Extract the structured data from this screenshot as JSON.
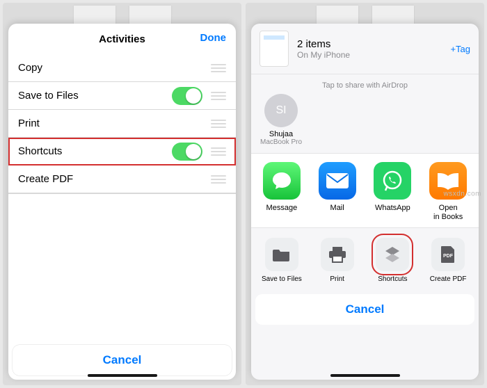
{
  "watermark": "wsxdn.com",
  "panel1": {
    "title": "Activities",
    "done": "Done",
    "rows": [
      {
        "label": "Copy",
        "toggle": null
      },
      {
        "label": "Save to Files",
        "toggle": true
      },
      {
        "label": "Print",
        "toggle": null
      },
      {
        "label": "Shortcuts",
        "toggle": true,
        "highlight": true
      },
      {
        "label": "Create PDF",
        "toggle": null
      }
    ],
    "cancel": "Cancel"
  },
  "panel2": {
    "header": {
      "items": "2 items",
      "location": "On My iPhone",
      "tag": "+Tag"
    },
    "airdrop": {
      "caption": "Tap to share with AirDrop",
      "contacts": [
        {
          "initials": "SI",
          "name": "Shujaa",
          "device": "MacBook Pro"
        }
      ]
    },
    "apps": [
      {
        "name": "Message",
        "icon": "message-icon"
      },
      {
        "name": "Mail",
        "icon": "mail-icon"
      },
      {
        "name": "WhatsApp",
        "icon": "whatsapp-icon"
      },
      {
        "name": "Open\nin Books",
        "icon": "books-icon"
      }
    ],
    "actions": [
      {
        "name": "Save to Files",
        "icon": "folder-icon"
      },
      {
        "name": "Print",
        "icon": "printer-icon"
      },
      {
        "name": "Shortcuts",
        "icon": "shortcuts-icon",
        "highlight": true
      },
      {
        "name": "Create PDF",
        "icon": "pdf-icon"
      }
    ],
    "cancel": "Cancel"
  }
}
